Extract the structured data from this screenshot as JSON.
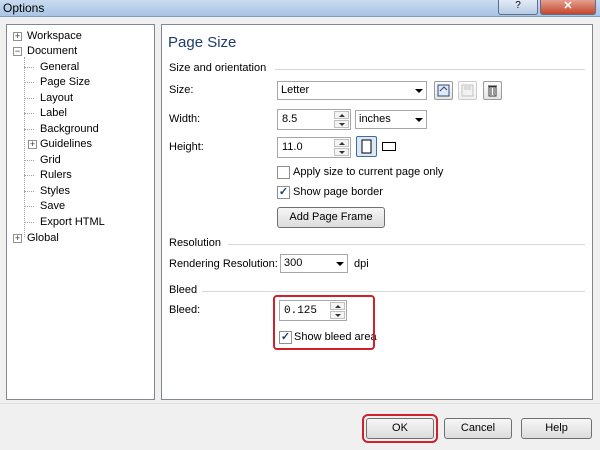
{
  "window": {
    "title": "Options"
  },
  "tree": {
    "items": [
      {
        "label": "Workspace",
        "exp": "+"
      },
      {
        "label": "Document",
        "exp": "−"
      },
      {
        "label": "General"
      },
      {
        "label": "Page Size"
      },
      {
        "label": "Layout"
      },
      {
        "label": "Label"
      },
      {
        "label": "Background"
      },
      {
        "label": "Guidelines",
        "exp": "+"
      },
      {
        "label": "Grid"
      },
      {
        "label": "Rulers"
      },
      {
        "label": "Styles"
      },
      {
        "label": "Save"
      },
      {
        "label": "Export HTML"
      },
      {
        "label": "Global",
        "exp": "+"
      }
    ]
  },
  "panel": {
    "title": "Page Size",
    "size_orientation": {
      "section_label": "Size and orientation",
      "size_label": "Size:",
      "size_value": "Letter",
      "width_label": "Width:",
      "width_value": "8.5",
      "units_value": "inches",
      "height_label": "Height:",
      "height_value": "11.0",
      "apply_current_only": {
        "label": "Apply size to current page only",
        "checked": false
      },
      "show_page_border": {
        "label": "Show page border",
        "checked": true
      },
      "add_page_frame_label": "Add Page Frame"
    },
    "resolution": {
      "section_label": "Resolution",
      "rendering_label": "Rendering Resolution:",
      "rendering_value": "300",
      "unit": "dpi"
    },
    "bleed": {
      "section_label": "Bleed",
      "bleed_label": "Bleed:",
      "bleed_value": "0.125",
      "show_bleed_area": {
        "label": "Show bleed area",
        "checked": true
      }
    }
  },
  "buttons": {
    "ok": "OK",
    "cancel": "Cancel",
    "help": "Help"
  },
  "colors": {
    "highlight": "#d0202a",
    "title": "#1f3c6e"
  }
}
